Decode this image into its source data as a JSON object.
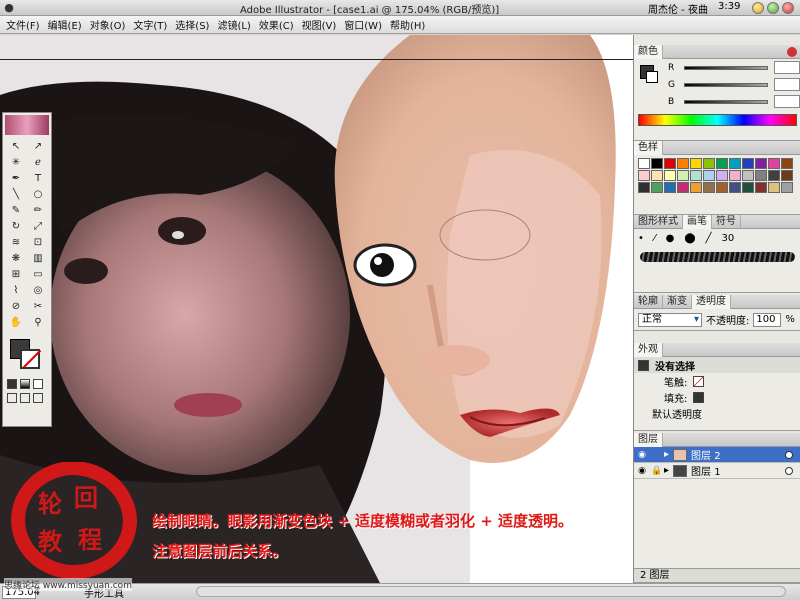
{
  "window": {
    "title": "Adobe Illustrator - [case1.ai @ 175.04% (RGB/预览)]",
    "user": "周杰伦 - 夜曲",
    "clock": "3:39"
  },
  "menu": [
    "文件(F)",
    "编辑(E)",
    "对象(O)",
    "文字(T)",
    "选择(S)",
    "滤镜(L)",
    "效果(C)",
    "视图(V)",
    "窗口(W)",
    "帮助(H)"
  ],
  "color_panel": {
    "tab": "颜色",
    "channels": [
      "R",
      "G",
      "B"
    ]
  },
  "swatch_panel": {
    "tab": "色样",
    "colors": [
      "#ffffff",
      "#000000",
      "#e00000",
      "#ff7f00",
      "#ffd700",
      "#90c000",
      "#00a050",
      "#00a0c0",
      "#2040c0",
      "#8020a0",
      "#e040a0",
      "#8b4513",
      "#ffcccc",
      "#ffe0b0",
      "#ffffb0",
      "#d0f0b0",
      "#b0e0d0",
      "#b0d0f0",
      "#d0b0f0",
      "#f0b0d0",
      "#c0c0c0",
      "#808080",
      "#404040",
      "#6b3b1b",
      "#303030",
      "#50a060",
      "#2070b0",
      "#c03070",
      "#f0a030",
      "#907050",
      "#a06030",
      "#405080",
      "#205040",
      "#803030",
      "#e0c080",
      "#a0a0a0"
    ]
  },
  "brush_panel": {
    "tabs": [
      "图形样式",
      "画笔",
      "符号"
    ],
    "size_label": "30"
  },
  "transparency_panel": {
    "tabs": [
      "轮廓",
      "渐变",
      "透明度"
    ],
    "blend_mode": "正常",
    "opacity_label": "不透明度:",
    "opacity_value": "100",
    "opacity_unit": "%"
  },
  "appearance_panel": {
    "tab": "外观",
    "selection": "没有选择",
    "stroke_label": "笔触:",
    "fill_label": "填充:",
    "default_opacity": "默认透明度"
  },
  "layers_panel": {
    "tab": "图层",
    "layers": [
      {
        "name": "图层 2",
        "selected": true
      },
      {
        "name": "图层 1",
        "selected": false
      }
    ],
    "footer": "2 图层"
  },
  "statusbar": {
    "zoom": "175.04",
    "tool": "手形工具"
  },
  "overlay": {
    "line1": "绘制眼睛。眼影用渐变色块 + 适度模糊或者羽化 + 适度透明。",
    "line2": "注意图层前后关系。",
    "seal_chars": [
      "轮",
      "回",
      "教",
      "程"
    ],
    "watermark": "思缘论坛 www.missyuan.com"
  },
  "colors": {
    "accent_red": "#e01818",
    "layer_select": "#3d6fc6",
    "skin": "#f0c8b0"
  }
}
